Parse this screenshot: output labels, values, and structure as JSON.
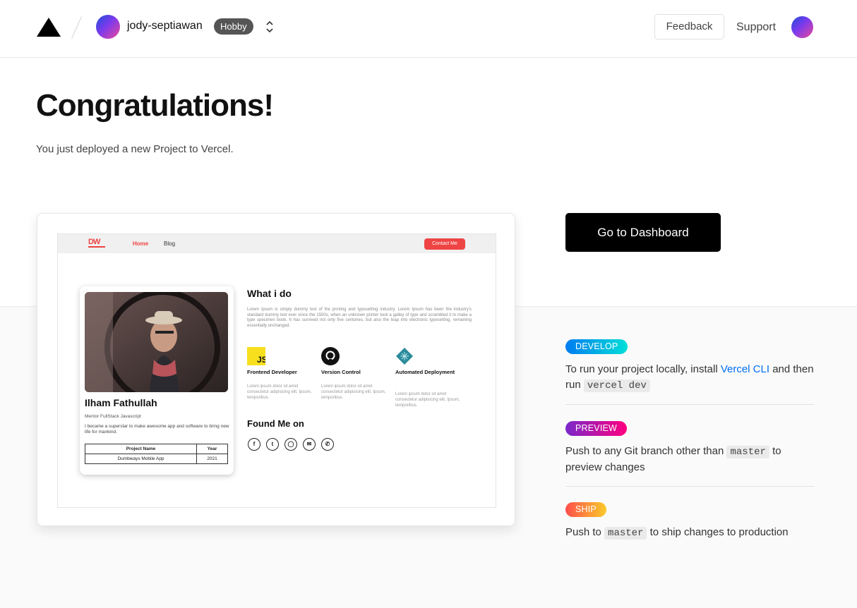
{
  "header": {
    "team_name": "jody-septiawan",
    "plan": "Hobby",
    "feedback_label": "Feedback",
    "support_label": "Support"
  },
  "hero": {
    "title": "Congratulations!",
    "subtitle": "You just deployed a new Project to Vercel."
  },
  "preview": {
    "logo": "DW",
    "nav": {
      "home": "Home",
      "blog": "Blog",
      "contact": "Contact Me"
    },
    "profile": {
      "name": "Ilham Fathullah",
      "role": "Mentor FullStack Javascript",
      "bio": "I became a superstar to make awesome app and software to bring new life for mankind.",
      "table": {
        "headers": [
          "Project Name",
          "Year"
        ],
        "rows": [
          [
            "Dumbways Mobile App",
            "2021"
          ]
        ]
      }
    },
    "what_i_do": {
      "title": "What i do",
      "body": "Lorem Ipsum is simply dummy text of the printing and typesetting industry. Lorem Ipsum has been the industry's standard dummy text ever since the 1500s, when an unknown printer took a galley of type and scrambled it to make a type specimen book. It has survived not only five centuries, but also the leap into electronic typesetting, remaining essentially unchanged."
    },
    "skills": [
      {
        "title": "Frontend Developer",
        "icon": "javascript-icon",
        "desc": "Lorem ipsum dolor sit amet consectetur adipisicing elit. Ipsum, temporibus."
      },
      {
        "title": "Version Control",
        "icon": "github-icon",
        "desc": "Lorem ipsum dolor sit amet consectetur adipisicing elit. Ipsum, temporibus."
      },
      {
        "title": "Automated Deployment",
        "icon": "netlify-icon",
        "desc": "Lorem ipsum dolor sit amet consectetur adipisicing elit. Ipsum, temporibus."
      }
    ],
    "found_me_on": "Found Me on",
    "social_icons": [
      "facebook-icon",
      "twitter-icon",
      "instagram-icon",
      "mail-icon",
      "whatsapp-icon"
    ]
  },
  "cta": {
    "dashboard_label": "Go to Dashboard"
  },
  "steps": {
    "develop": {
      "badge": "DEVELOP",
      "text_1": "To run your project locally, install ",
      "link": "Vercel CLI",
      "text_2": " and then run ",
      "code": "vercel dev",
      "gradient": [
        "#007cf0",
        "#00dfd8"
      ]
    },
    "preview": {
      "badge": "PREVIEW",
      "text_1": "Push to any Git branch other than ",
      "code": "master",
      "text_2": " to preview changes",
      "gradient": [
        "#7928ca",
        "#ff0080"
      ]
    },
    "ship": {
      "badge": "SHIP",
      "text_1": "Push to ",
      "code": "master",
      "text_2": " to ship changes to production",
      "gradient": [
        "#ff4d4d",
        "#f9cb28"
      ]
    }
  }
}
